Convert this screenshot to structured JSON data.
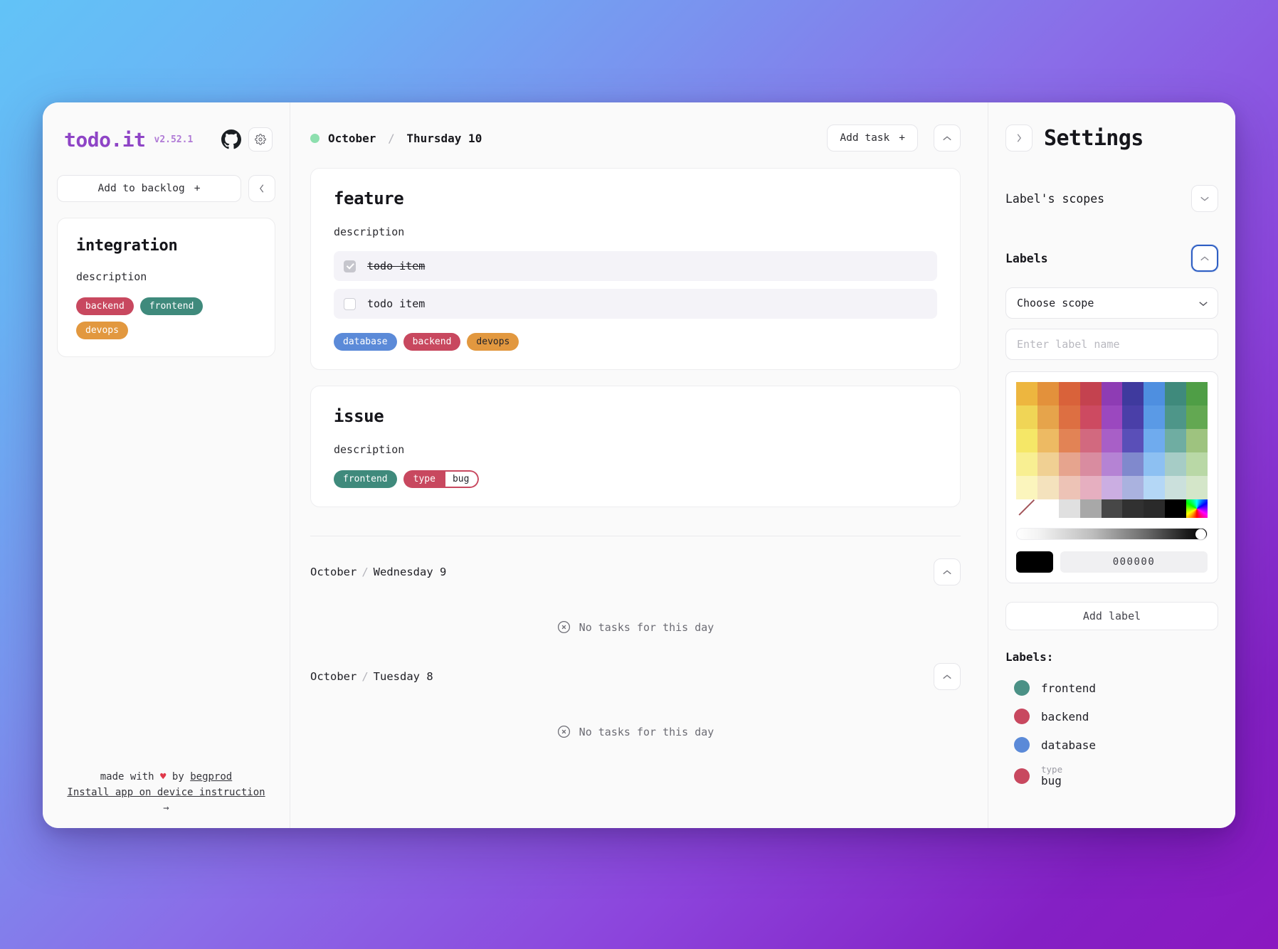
{
  "sidebar": {
    "brand": {
      "name": "todo.it",
      "version": "v2.52.1"
    },
    "github_icon": "github-icon",
    "settings_icon": "gear-icon",
    "backlog_button": "Add to backlog",
    "backlog_plus": "+",
    "collapse_icon": "chevron-left-icon",
    "backlog_card": {
      "title": "integration",
      "description": "description",
      "chips": [
        {
          "text": "backend",
          "color": "#c8485f",
          "text_color": "#ffffff"
        },
        {
          "text": "frontend",
          "color": "#3f8a7c",
          "text_color": "#ffffff"
        },
        {
          "text": "devops",
          "color": "#e2983f",
          "text_color": "#ffffff"
        }
      ]
    },
    "footer": {
      "made_with": "made with",
      "heart": "♥",
      "by": "by",
      "author": "begprod",
      "install_link": "Install app on device instruction",
      "arrow": "→"
    }
  },
  "main": {
    "header": {
      "month": "October",
      "separator": "/",
      "day": "Thursday 10",
      "dot_color": "#8ddfae",
      "add_task": "Add task",
      "add_task_plus": "+",
      "collapse_icon": "chevron-up-icon"
    },
    "cards": [
      {
        "title": "feature",
        "description": "description",
        "todos": [
          {
            "text": "todo item",
            "checked": true
          },
          {
            "text": "todo item",
            "checked": false
          }
        ],
        "chips": [
          {
            "text": "database",
            "color": "#5b8ad8",
            "text_color": "#ffffff"
          },
          {
            "text": "backend",
            "color": "#c8485f",
            "text_color": "#ffffff"
          },
          {
            "text": "devops",
            "color": "#e2983f",
            "text_color": "#24242a"
          }
        ]
      },
      {
        "title": "issue",
        "description": "description",
        "todos": [],
        "chips": [
          {
            "text": "frontend",
            "color": "#3f8a7c",
            "text_color": "#ffffff"
          }
        ],
        "compound_chip": {
          "scope": "type",
          "value": "bug",
          "color": "#c8485f"
        }
      }
    ],
    "days": [
      {
        "month": "October",
        "separator": "/",
        "day": "Wednesday 9",
        "empty_text": "No tasks for this day",
        "empty_icon": "x-circle-icon",
        "collapse_icon": "chevron-up-icon"
      },
      {
        "month": "October",
        "separator": "/",
        "day": "Tuesday 8",
        "empty_text": "No tasks for this day",
        "empty_icon": "x-circle-icon",
        "collapse_icon": "chevron-up-icon"
      }
    ]
  },
  "settings": {
    "title": "Settings",
    "close_icon": "chevron-right-icon",
    "scopes_section": {
      "title": "Label's scopes",
      "chevron": "chevron-down-icon"
    },
    "labels_section": {
      "title": "Labels",
      "chevron": "chevron-up-icon",
      "focused": true
    },
    "scope_select": {
      "value": "Choose scope",
      "chevron": "chevron-down-icon"
    },
    "label_name_input": {
      "value": "",
      "placeholder": "Enter label name"
    },
    "color_picker": {
      "rows": [
        [
          "#edb63f",
          "#e3913b",
          "#d9623a",
          "#c4424f",
          "#8e3cb4",
          "#3f3a9e",
          "#4e8fe0",
          "#3f8a7c",
          "#4f9e46"
        ],
        [
          "#f0d556",
          "#e6a44b",
          "#dd6f42",
          "#cd4a61",
          "#9b48bf",
          "#4a3fa8",
          "#5a9ae6",
          "#4e9689",
          "#63a852"
        ],
        [
          "#f5e767",
          "#edba63",
          "#e28355",
          "#d2697f",
          "#a85fc7",
          "#5a4fb8",
          "#6fabee",
          "#6fada2",
          "#9ec37f"
        ],
        [
          "#f8ef92",
          "#f0d093",
          "#e6a48e",
          "#d98ca0",
          "#b583d4",
          "#8089cd",
          "#8dc0f2",
          "#a6ccc6",
          "#b9d8a6"
        ],
        [
          "#fbf5bd",
          "#f4e2bd",
          "#edc3b6",
          "#e6afc0",
          "#cbaee2",
          "#aab2df",
          "#b4d7f6",
          "#cbe0dc",
          "#d4e6c9"
        ]
      ],
      "bottom_row": [
        "none",
        "#ffffff",
        "#e0e0e0",
        "#a8a8a8",
        "#474747",
        "#313131",
        "#2a2a2a",
        "#000000",
        "rainbow"
      ],
      "shade_slider_value": 100,
      "hex_preview": "#000000",
      "hex_value": "000000"
    },
    "add_label_button": "Add label",
    "labels_heading": "Labels:",
    "labels": [
      {
        "name": "frontend",
        "color": "#4b9186"
      },
      {
        "name": "backend",
        "color": "#c8485f"
      },
      {
        "name": "database",
        "color": "#5b8ad8"
      },
      {
        "scope": "type",
        "name": "bug",
        "color": "#c8485f"
      }
    ]
  }
}
